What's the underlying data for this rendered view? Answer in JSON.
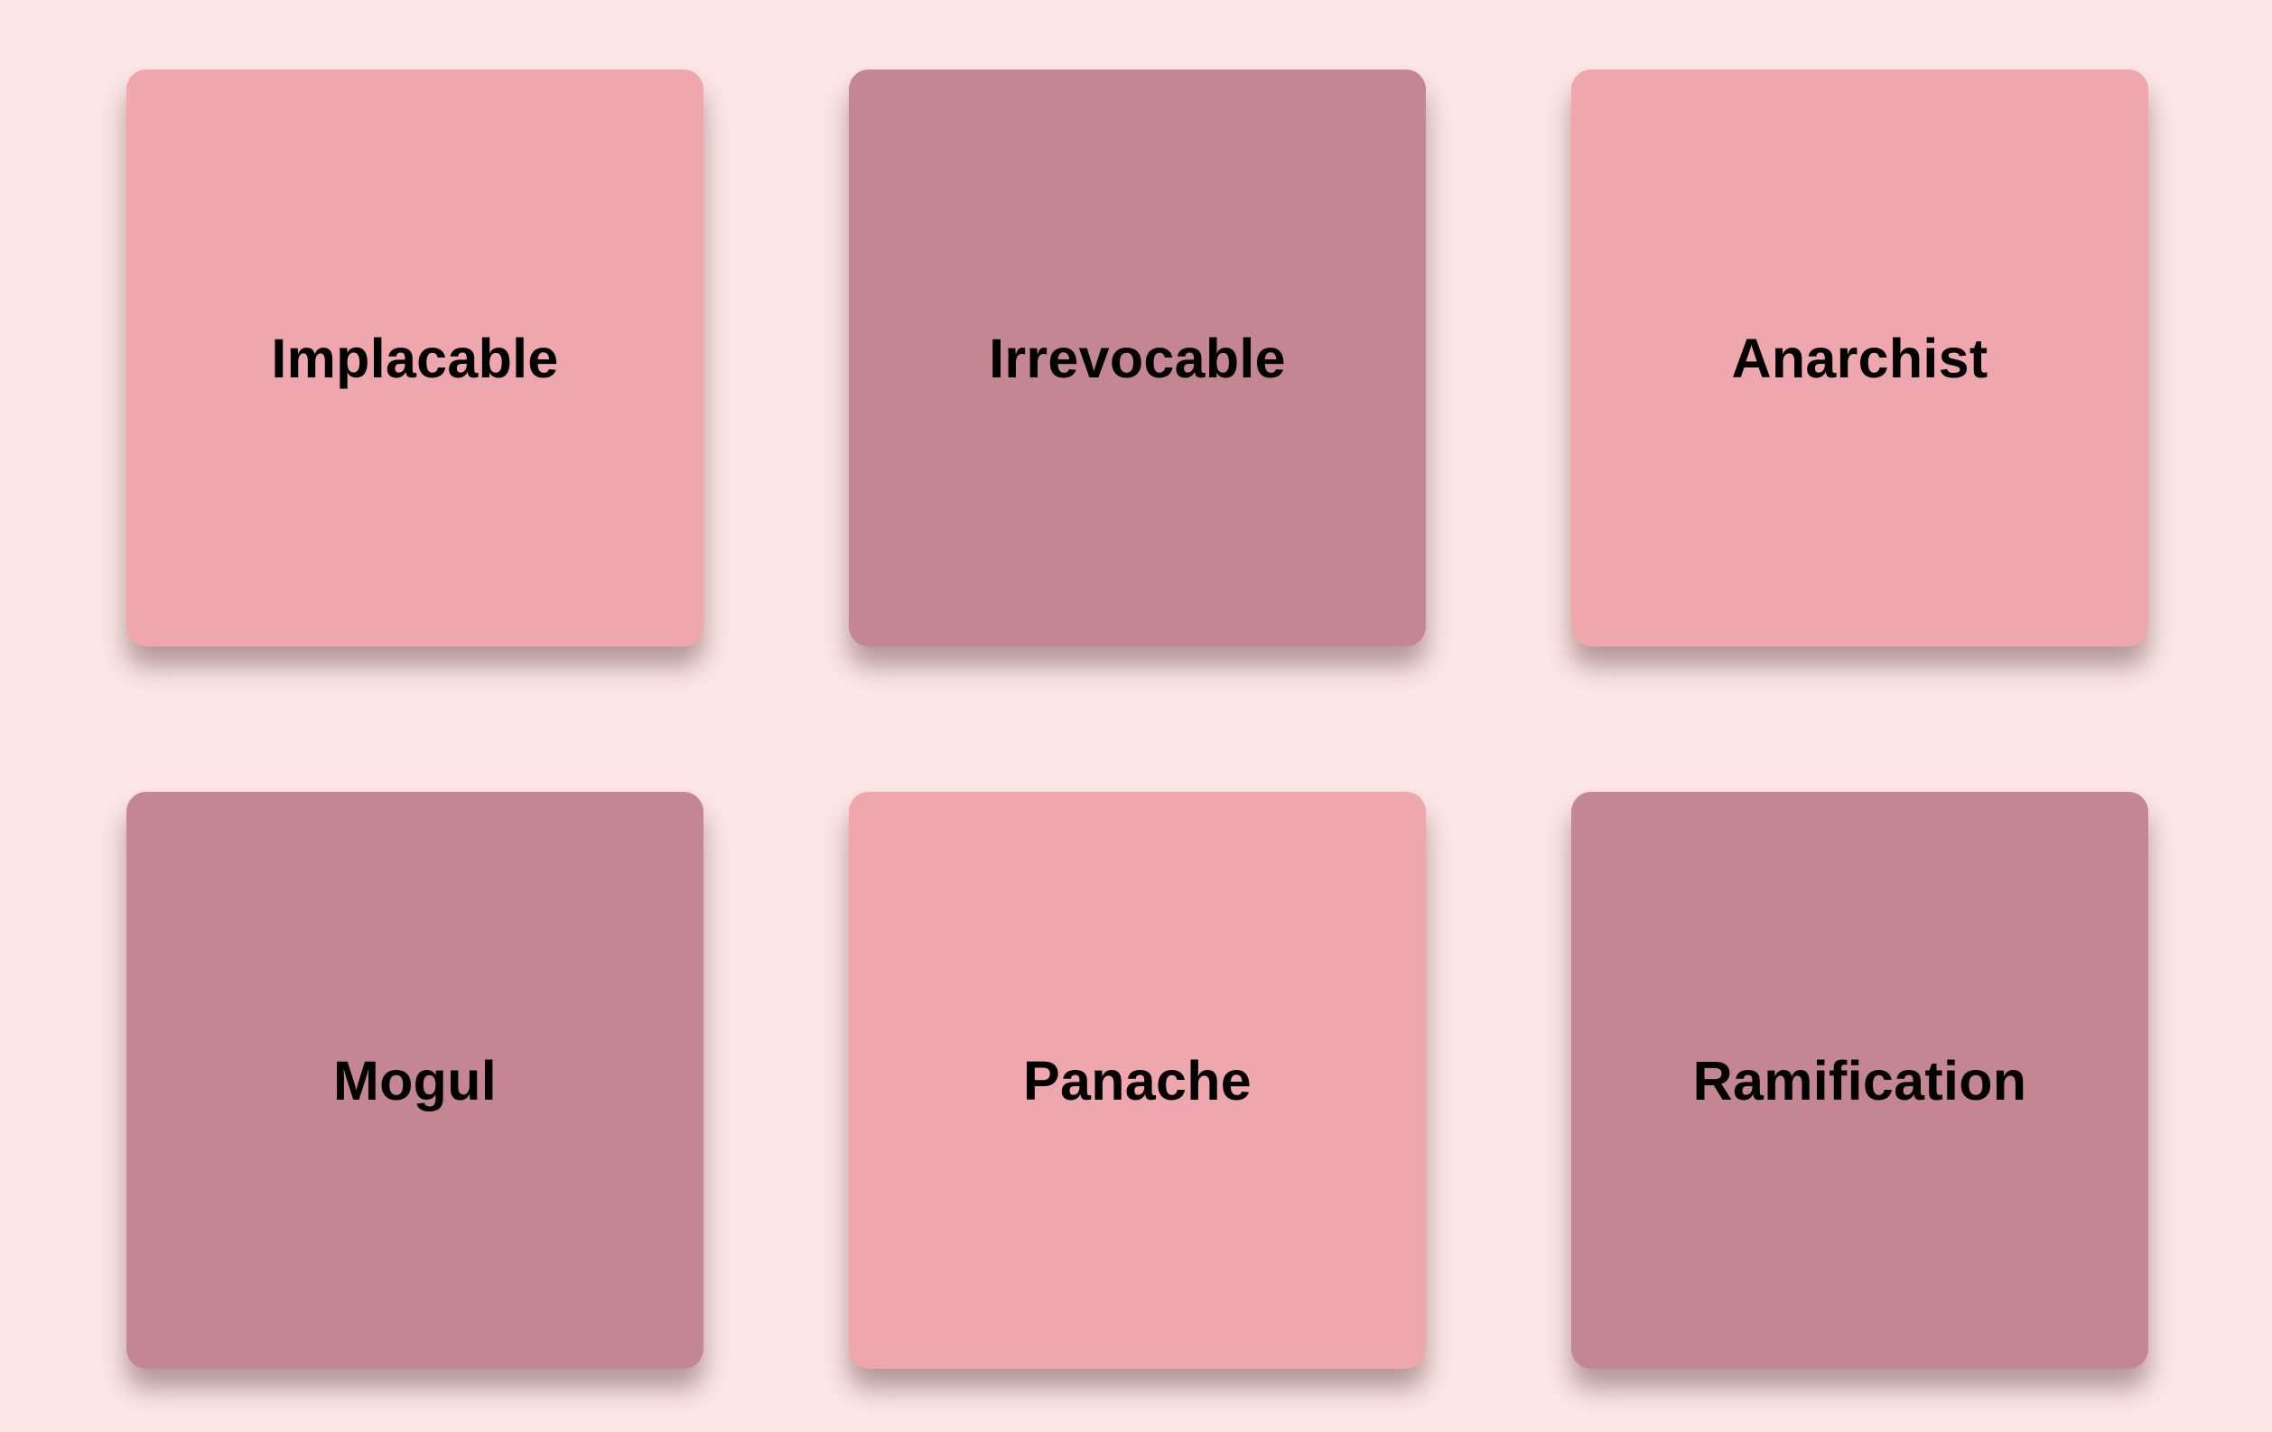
{
  "colors": {
    "background": "#fde6e6",
    "card_light": "#efa7ae",
    "card_dark": "#c48693",
    "text": "#000000"
  },
  "cards": [
    {
      "label": "Implacable",
      "color": "#efa7ae"
    },
    {
      "label": "Irrevocable",
      "color": "#c48693"
    },
    {
      "label": "Anarchist",
      "color": "#efa7ae"
    },
    {
      "label": "Mogul",
      "color": "#c48693"
    },
    {
      "label": "Panache",
      "color": "#efa7ae"
    },
    {
      "label": "Ramification",
      "color": "#c48693"
    }
  ]
}
